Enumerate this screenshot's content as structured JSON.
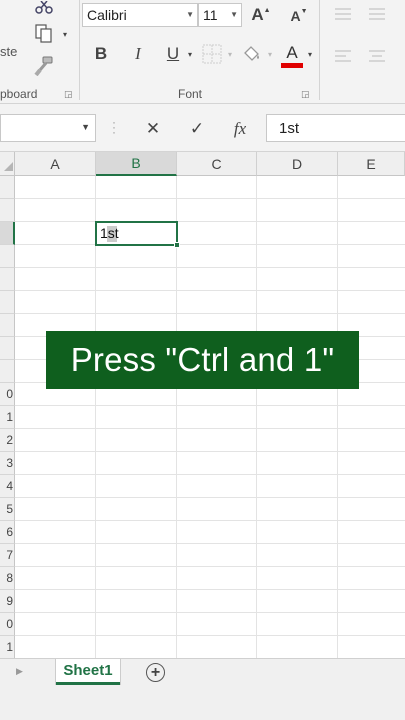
{
  "ribbon": {
    "clipboard": {
      "paste_label": "ste",
      "group_label": "pboard"
    },
    "font": {
      "name": "Calibri",
      "size": "11",
      "increase_label": "A",
      "decrease_label": "A",
      "bold_label": "B",
      "italic_label": "I",
      "underline_label": "U",
      "font_color_label": "A",
      "font_color": "#e00000",
      "group_label": "Font"
    }
  },
  "formula_bar": {
    "name_box_value": "",
    "cancel_glyph": "✕",
    "enter_glyph": "✓",
    "fx_label": "fx",
    "content": "1st"
  },
  "grid": {
    "columns": [
      "A",
      "B",
      "C",
      "D",
      "E"
    ],
    "selected_column": "B",
    "row_headers": [
      "",
      "",
      "",
      "",
      "",
      "",
      "",
      "",
      "",
      "0",
      "1",
      "2",
      "3",
      "4",
      "5",
      "6",
      "7",
      "8",
      "9",
      "0",
      "1"
    ],
    "active_cell": {
      "value": "1st"
    }
  },
  "overlay": {
    "caption": "Press \"Ctrl and 1\""
  },
  "sheet_tabs": {
    "tabs": [
      {
        "name": "Sheet1",
        "active": true
      }
    ],
    "add_glyph": "+"
  },
  "colors": {
    "accent": "#217346",
    "banner": "#0f5f1e"
  }
}
